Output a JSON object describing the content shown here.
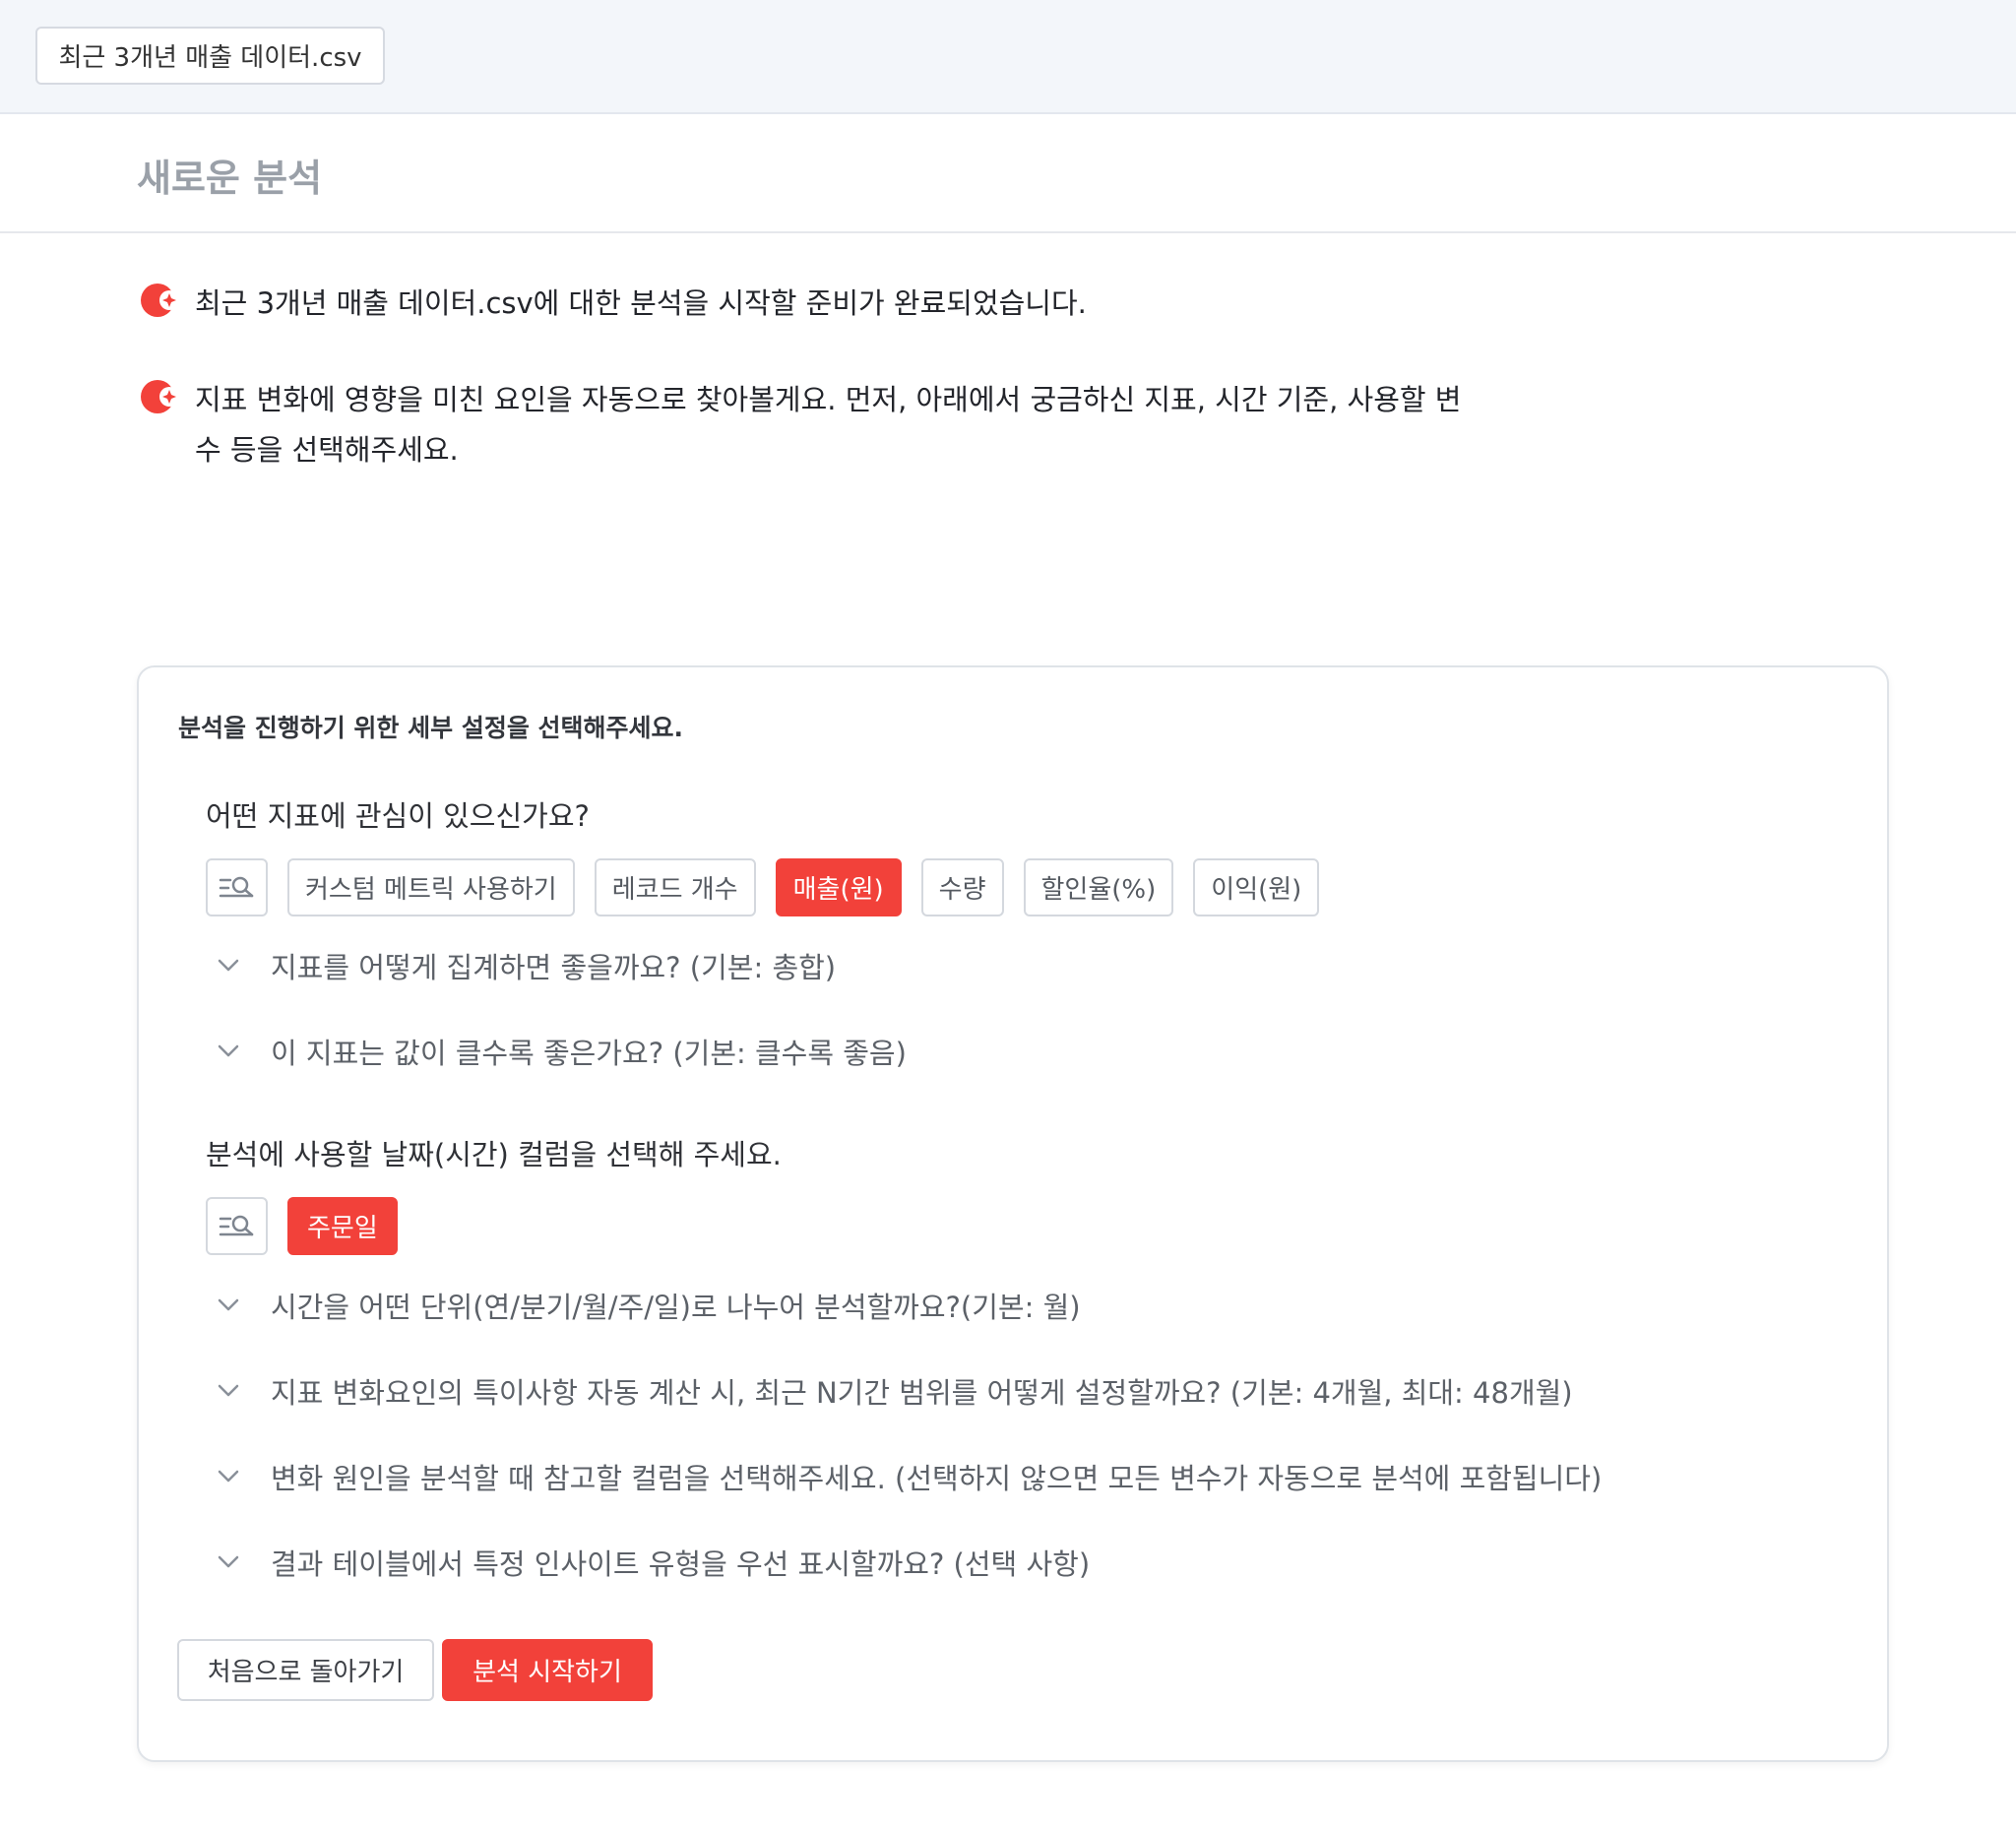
{
  "file_tab": {
    "label": "최근 3개년 매출 데이터.csv"
  },
  "page": {
    "title": "새로운 분석"
  },
  "messages": [
    {
      "text": "최근 3개년 매출 데이터.csv에 대한 분석을 시작할 준비가 완료되었습니다."
    },
    {
      "text": "지표 변화에 영향을 미친 요인을 자동으로 찾아볼게요. 먼저, 아래에서 궁금하신 지표, 시간 기준, 사용할 변수 등을 선택해주세요."
    }
  ],
  "settings": {
    "heading": "분석을 진행하기 위한 세부 설정을 선택해주세요.",
    "metric_question": "어떤 지표에 관심이 있으신가요?",
    "metric_options": [
      {
        "label": "커스텀 메트릭 사용하기",
        "selected": false
      },
      {
        "label": "레코드 개수",
        "selected": false
      },
      {
        "label": "매출(원)",
        "selected": true
      },
      {
        "label": "수량",
        "selected": false
      },
      {
        "label": "할인율(%)",
        "selected": false
      },
      {
        "label": "이익(원)",
        "selected": false
      }
    ],
    "metric_accordions": [
      "지표를 어떻게 집계하면 좋을까요? (기본: 총합)",
      "이 지표는 값이 클수록 좋은가요? (기본: 클수록 좋음)"
    ],
    "date_question": "분석에 사용할 날짜(시간) 컬럼을 선택해 주세요.",
    "date_options": [
      {
        "label": "주문일",
        "selected": true
      }
    ],
    "date_accordions": [
      "시간을 어떤 단위(연/분기/월/주/일)로 나누어 분석할까요?(기본: 월)",
      "지표 변화요인의 특이사항 자동 계산 시, 최근 N기간 범위를 어떻게 설정할까요? (기본: 4개월, 최대: 48개월)",
      "변화 원인을 분석할 때 참고할 컬럼을 선택해주세요. (선택하지 않으면 모든 변수가 자동으로 분석에 포함됩니다)",
      "결과 테이블에서 특정 인사이트 유형을 우선 표시할까요? (선택 사항)"
    ]
  },
  "actions": {
    "back_label": "처음으로 돌아가기",
    "start_label": "분석 시작하기"
  },
  "colors": {
    "accent": "#f2413a",
    "topbar_bg": "#f3f6fa",
    "title_gray": "#9aa0a8"
  },
  "icons": {
    "assistant": "sparkle-badge-icon",
    "search_list": "list-search-icon",
    "chevron": "chevron-down-icon"
  }
}
